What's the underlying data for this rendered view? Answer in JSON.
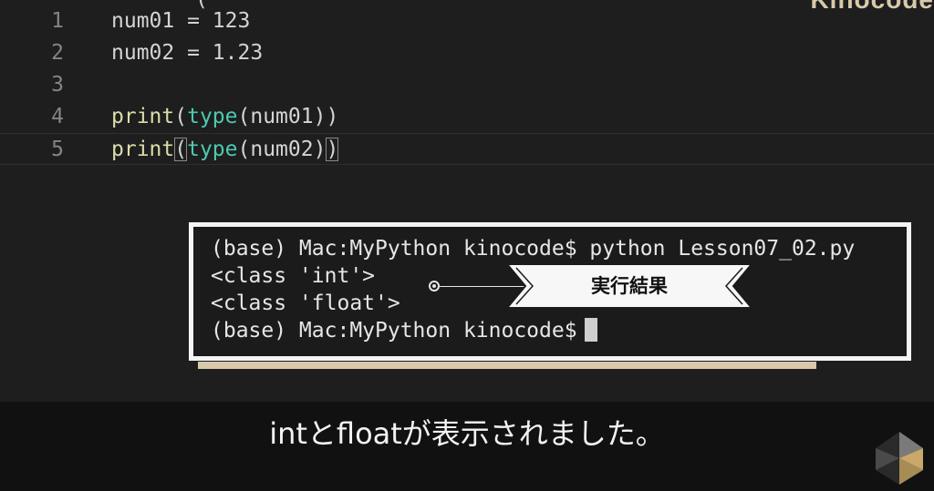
{
  "editor": {
    "cut_top_text": "(",
    "lines": [
      {
        "no": "1",
        "parts": [
          {
            "t": "num01",
            "k": "var"
          },
          {
            "t": " = ",
            "k": "punct"
          },
          {
            "t": "123",
            "k": "num"
          }
        ]
      },
      {
        "no": "2",
        "parts": [
          {
            "t": "num02",
            "k": "var"
          },
          {
            "t": " = ",
            "k": "punct"
          },
          {
            "t": "1.23",
            "k": "num"
          }
        ]
      },
      {
        "no": "3",
        "parts": []
      },
      {
        "no": "4",
        "parts": [
          {
            "t": "print",
            "k": "fn"
          },
          {
            "t": "(",
            "k": "punct"
          },
          {
            "t": "type",
            "k": "bi"
          },
          {
            "t": "(",
            "k": "punct"
          },
          {
            "t": "num01",
            "k": "var"
          },
          {
            "t": "))",
            "k": "punct"
          }
        ]
      },
      {
        "no": "5",
        "parts": [
          {
            "t": "print",
            "k": "fn"
          },
          {
            "t": "(",
            "k": "punct",
            "match": true
          },
          {
            "t": "type",
            "k": "bi"
          },
          {
            "t": "(",
            "k": "punct"
          },
          {
            "t": "num02",
            "k": "var"
          },
          {
            "t": ")",
            "k": "punct"
          },
          {
            "t": ")",
            "k": "punct",
            "match": true
          }
        ]
      }
    ]
  },
  "brand": {
    "logo_text": "Kinocode"
  },
  "terminal": {
    "lines": [
      "(base) Mac:MyPython kinocode$ python Lesson07_02.py",
      "<class 'int'>",
      "<class 'float'>",
      "(base) Mac:MyPython kinocode$"
    ],
    "callout": "実行結果"
  },
  "subtitle": {
    "text": "intとfloatが表示されました。"
  },
  "colors": {
    "background": "#1e1e1e",
    "function": "#dcdcaa",
    "builtin": "#4ec9b0",
    "text": "#d4d4d4",
    "line_number": "#858585",
    "accent_beige": "#d9c8a9"
  }
}
